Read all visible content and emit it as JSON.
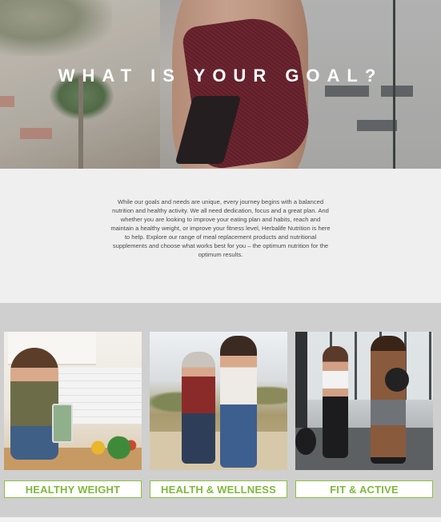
{
  "hero": {
    "title": "WHAT IS YOUR GOAL?"
  },
  "intro": {
    "text": "While our goals and needs are unique, every journey begins with a balanced nutrition and healthy activity. We all need dedication, focus and a great plan. And whether you are looking to improve your eating plan and habits, reach and maintain a healthy weight, or improve your fitness level, Herbalife Nutrition is here to help. Explore our range of meal replacement products and nutritional supplements and choose what works best for you – the optimum nutrition for the optimum results."
  },
  "goals": [
    {
      "label": "HEALTHY WEIGHT"
    },
    {
      "label": "HEALTH & WELLNESS"
    },
    {
      "label": "FIT & ACTIVE"
    }
  ],
  "colors": {
    "accent_green": "#7fb93b",
    "section_gray": "#cfcfcf",
    "intro_bg": "#efefef"
  }
}
